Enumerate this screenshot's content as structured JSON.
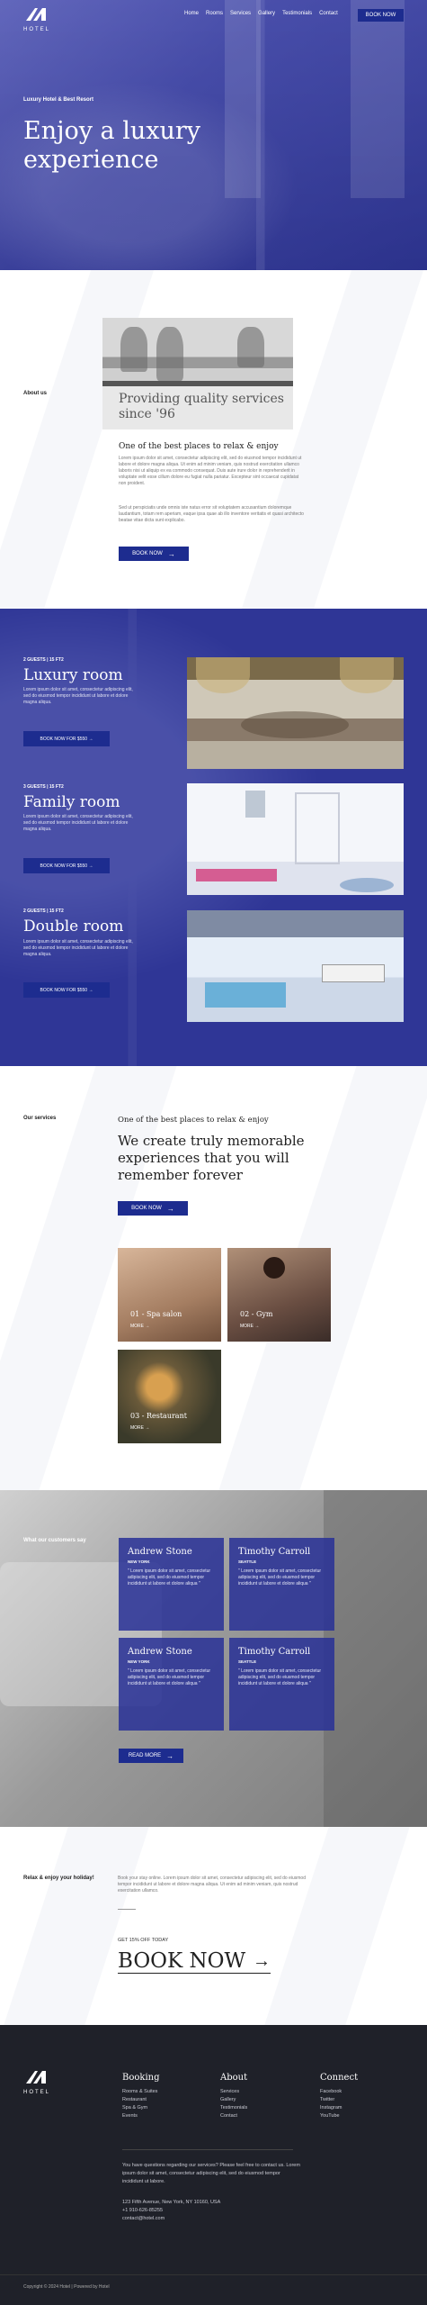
{
  "nav": {
    "items": [
      "Home",
      "Rooms",
      "Services",
      "Gallery",
      "Testimonials",
      "Contact"
    ],
    "book_label": "BOOK NOW"
  },
  "hero": {
    "tag": "Luxury Hotel & Best Resort",
    "title": "Enjoy a luxury experience"
  },
  "about": {
    "label": "About us",
    "img_title": "Providing quality services since '96",
    "subtitle": "One of the best places to relax & enjoy",
    "para1": "Lorem ipsum dolor sit amet, consectetur adipiscing elit, sed do eiusmod tempor incididunt ut labore et dolore magna aliqua. Ut enim ad minim veniam, quis nostrud exercitation ullamco laboris nisi ut aliquip ex ea commodo consequat. Duis aute irure dolor in reprehenderit in voluptate velit esse cillum dolore eu fugiat nulla pariatur. Excepteur sint occaecat cupidatat non proident.",
    "para2": "Sed ut perspiciatis unde omnis iste natus error sit voluptatem accusantium doloremque laudantium, totam rem aperiam, eaque ipsa quae ab illo inventore veritatis et quasi architecto beatae vitae dicta sunt explicabo.",
    "button": "BOOK NOW"
  },
  "rooms": [
    {
      "tag": "2 GUESTS | 15 FT2",
      "title": "Luxury room",
      "desc": "Lorem ipsum dolor sit amet, consectetur adipiscing elit, sed do eiusmod tempor incididunt ut labore et dolore magna aliqua.",
      "button": "BOOK NOW FOR $550"
    },
    {
      "tag": "3 GUESTS | 15 FT2",
      "title": "Family room",
      "desc": "Lorem ipsum dolor sit amet, consectetur adipiscing elit, sed do eiusmod tempor incididunt ut labore et dolore magna aliqua.",
      "button": "BOOK NOW FOR $550"
    },
    {
      "tag": "2 GUESTS | 15 FT2",
      "title": "Double room",
      "desc": "Lorem ipsum dolor sit amet, consectetur adipiscing elit, sed do eiusmod tempor incididunt ut labore et dolore magna aliqua.",
      "button": "BOOK NOW FOR $550"
    }
  ],
  "services": {
    "label": "Our services",
    "subtitle": "One of the best places to relax & enjoy",
    "title": "We create truly memorable experiences that you will remember forever",
    "button": "BOOK NOW",
    "cards": [
      {
        "caption": "01 - Spa salon",
        "more": "MORE"
      },
      {
        "caption": "02 - Gym",
        "more": "MORE"
      },
      {
        "caption": "03 - Restaurant",
        "more": "MORE"
      }
    ]
  },
  "testimonials": {
    "label": "What our customers say",
    "cards": [
      {
        "name": "Andrew Stone",
        "city": "NEW YORK",
        "quote": "\" Lorem ipsum dolor sit amet, consectetur adipiscing elit, sed do eiusmod tempor incididunt ut labore et dolore aliqua \""
      },
      {
        "name": "Timothy Carroll",
        "city": "SEATTLE",
        "quote": "\" Lorem ipsum dolor sit amet, consectetur adipiscing elit, sed do eiusmod tempor incididunt ut labore et dolore aliqua \""
      },
      {
        "name": "Andrew Stone",
        "city": "NEW YORK",
        "quote": "\" Lorem ipsum dolor sit amet, consectetur adipiscing elit, sed do eiusmod tempor incididunt ut labore et dolore aliqua \""
      },
      {
        "name": "Timothy Carroll",
        "city": "SEATTLE",
        "quote": "\" Lorem ipsum dolor sit amet, consectetur adipiscing elit, sed do eiusmod tempor incididunt ut labore et dolore aliqua \""
      }
    ],
    "button": "READ MORE"
  },
  "cta": {
    "label": "Relax & enjoy your holiday!",
    "para": "Book your stay online. Lorem ipsum dolor sit amet, consectetur adipiscing elit, sed do eiusmod tempor incididunt ut labore et dolore magna aliqua. Ut enim ad minim veniam, quis nostrud exercitation ullamco.",
    "offer": "GET 15% OFF TODAY",
    "big": "BOOK NOW"
  },
  "footer": {
    "logo_text": "HOTEL",
    "cols": [
      {
        "title": "Booking",
        "items": [
          "Rooms & Suites",
          "Restaurant",
          "Spa & Gym",
          "Events"
        ]
      },
      {
        "title": "About",
        "items": [
          "Services",
          "Gallery",
          "Testimonials",
          "Contact"
        ]
      },
      {
        "title": "Connect",
        "items": [
          "Facebook",
          "Twitter",
          "Instagram",
          "YouTube"
        ]
      }
    ],
    "note": "You have questions regarding our services? Please feel free to contact us. Lorem ipsum dolor sit amet, consectetur adipiscing elit, sed do eiusmod tempor incididunt ut labore.",
    "address": "123 Fifth Avenue, New York, NY 10160, USA",
    "phone": "+1 910-626-85255",
    "email": "contact@hotel.com",
    "copyright": "Copyright © 2024 Hotel | Powered by Hotel"
  },
  "colors": {
    "primary": "#2f3696",
    "navy_button": "#1d2c8f",
    "footer_bg": "#1f2129"
  }
}
